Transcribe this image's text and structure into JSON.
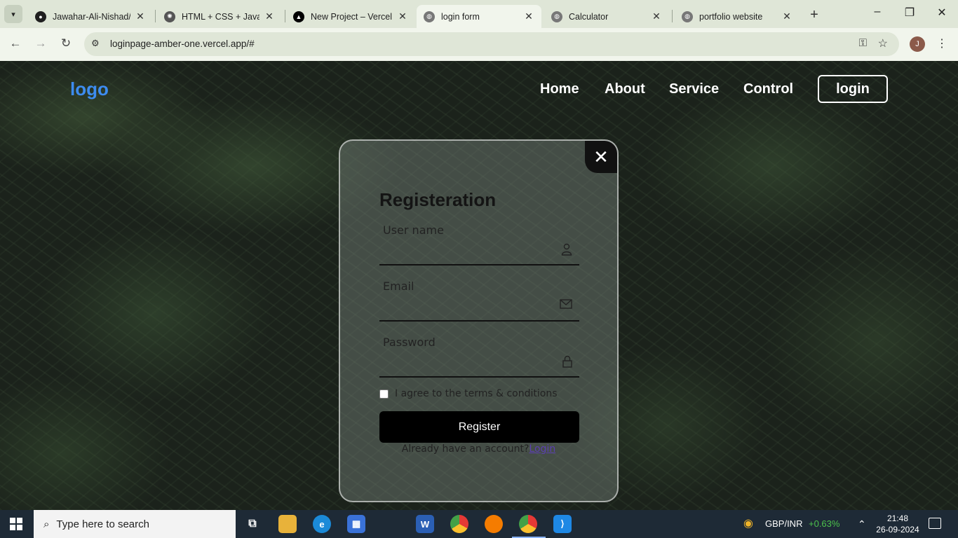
{
  "browser": {
    "tabs": [
      {
        "title": "Jawahar-Ali-Nishad/lo",
        "favicon": "github-icon",
        "active": false
      },
      {
        "title": "HTML + CSS + Javasc",
        "favicon": "openai-icon",
        "active": false
      },
      {
        "title": "New Project – Vercel",
        "favicon": "vercel-icon",
        "active": false
      },
      {
        "title": "login form",
        "favicon": "globe-icon",
        "active": true
      },
      {
        "title": "Calculator",
        "favicon": "globe-icon",
        "active": false
      },
      {
        "title": "portfolio website",
        "favicon": "globe-icon",
        "active": false
      }
    ],
    "url": "loginpage-amber-one.vercel.app/#",
    "profile_initial": "J"
  },
  "site": {
    "logo": "logo",
    "nav": [
      "Home",
      "About",
      "Service",
      "Control"
    ],
    "login_button": "login"
  },
  "form": {
    "title": "Registeration",
    "fields": [
      {
        "label": "User name",
        "icon": "person-icon",
        "value": ""
      },
      {
        "label": "Email",
        "icon": "mail-icon",
        "value": ""
      },
      {
        "label": "Password",
        "icon": "lock-icon",
        "value": ""
      }
    ],
    "agree_label": "I agree to the terms & conditions",
    "agree_checked": false,
    "submit": "Register",
    "already_text": "Already have an account?",
    "login_link": "Login"
  },
  "taskbar": {
    "search_placeholder": "Type here to search",
    "ticker": "GBP/INR",
    "ticker_change": "+0.63%",
    "time": "21:48",
    "date": "26-09-2024"
  },
  "colors": {
    "logo": "#3d8cf0",
    "ticker_positive": "#4cc14c",
    "tab_strip": "#dfe6d7",
    "active_tab": "#f1f5ec"
  }
}
